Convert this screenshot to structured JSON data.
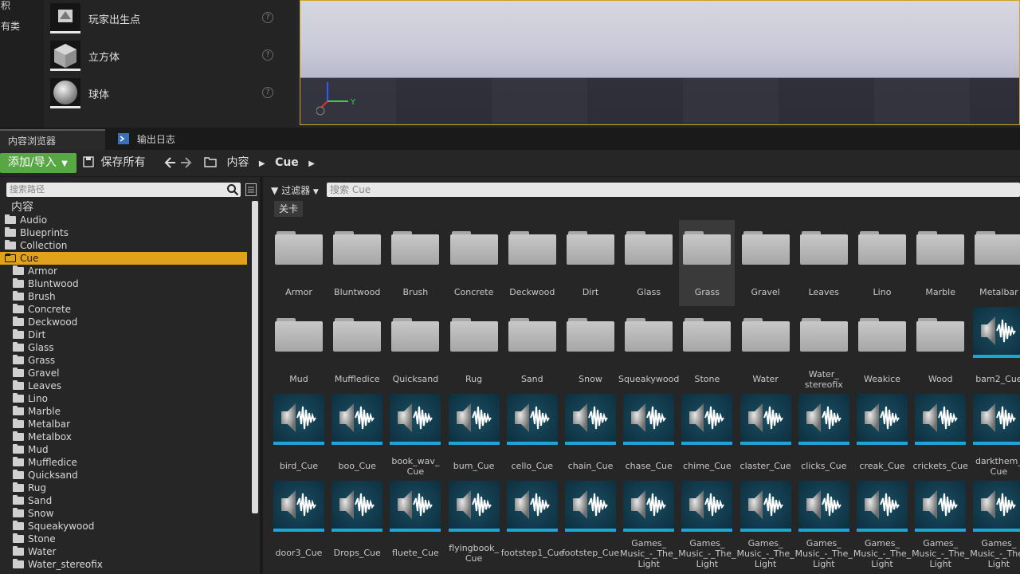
{
  "left_categories": [
    "积",
    "有类"
  ],
  "place_items": [
    {
      "label": "玩家出生点",
      "icon": "player-start-icon"
    },
    {
      "label": "立方体",
      "icon": "cube-icon"
    },
    {
      "label": "球体",
      "icon": "sphere-icon"
    }
  ],
  "viewport": {
    "axis_y_label": "Y"
  },
  "tabs": {
    "content_browser": "内容浏览器",
    "output_log": "输出日志"
  },
  "toolbar": {
    "add_import": "添加/导入",
    "save_all": "保存所有",
    "crumbs": [
      "内容",
      "Cue"
    ]
  },
  "tree_search_placeholder": "搜索路径",
  "tree": [
    {
      "label": "内容",
      "level": 0
    },
    {
      "label": "Audio",
      "level": 1
    },
    {
      "label": "Blueprints",
      "level": 1
    },
    {
      "label": "Collection",
      "level": 1
    },
    {
      "label": "Cue",
      "level": 1,
      "selected": true
    },
    {
      "label": "Armor",
      "level": 2
    },
    {
      "label": "Bluntwood",
      "level": 2
    },
    {
      "label": "Brush",
      "level": 2
    },
    {
      "label": "Concrete",
      "level": 2
    },
    {
      "label": "Deckwood",
      "level": 2
    },
    {
      "label": "Dirt",
      "level": 2
    },
    {
      "label": "Glass",
      "level": 2
    },
    {
      "label": "Grass",
      "level": 2
    },
    {
      "label": "Gravel",
      "level": 2
    },
    {
      "label": "Leaves",
      "level": 2
    },
    {
      "label": "Lino",
      "level": 2
    },
    {
      "label": "Marble",
      "level": 2
    },
    {
      "label": "Metalbar",
      "level": 2
    },
    {
      "label": "Metalbox",
      "level": 2
    },
    {
      "label": "Mud",
      "level": 2
    },
    {
      "label": "Muffledice",
      "level": 2
    },
    {
      "label": "Quicksand",
      "level": 2
    },
    {
      "label": "Rug",
      "level": 2
    },
    {
      "label": "Sand",
      "level": 2
    },
    {
      "label": "Snow",
      "level": 2
    },
    {
      "label": "Squeakywood",
      "level": 2
    },
    {
      "label": "Stone",
      "level": 2
    },
    {
      "label": "Water",
      "level": 2
    },
    {
      "label": "Water_stereofix",
      "level": 2
    }
  ],
  "filter": {
    "label": "过滤器",
    "search_placeholder": "搜索 Cue",
    "chip": "关卡"
  },
  "assets": [
    {
      "name": "Armor",
      "kind": "folder"
    },
    {
      "name": "Bluntwood",
      "kind": "folder"
    },
    {
      "name": "Brush",
      "kind": "folder"
    },
    {
      "name": "Concrete",
      "kind": "folder"
    },
    {
      "name": "Deckwood",
      "kind": "folder"
    },
    {
      "name": "Dirt",
      "kind": "folder"
    },
    {
      "name": "Glass",
      "kind": "folder"
    },
    {
      "name": "Grass",
      "kind": "folder",
      "hover": true
    },
    {
      "name": "Gravel",
      "kind": "folder"
    },
    {
      "name": "Leaves",
      "kind": "folder"
    },
    {
      "name": "Lino",
      "kind": "folder"
    },
    {
      "name": "Marble",
      "kind": "folder"
    },
    {
      "name": "Metalbar",
      "kind": "folder"
    },
    {
      "name": "Mud",
      "kind": "folder"
    },
    {
      "name": "Muffledice",
      "kind": "folder"
    },
    {
      "name": "Quicksand",
      "kind": "folder"
    },
    {
      "name": "Rug",
      "kind": "folder"
    },
    {
      "name": "Sand",
      "kind": "folder"
    },
    {
      "name": "Snow",
      "kind": "folder"
    },
    {
      "name": "Squeakywood",
      "kind": "folder"
    },
    {
      "name": "Stone",
      "kind": "folder"
    },
    {
      "name": "Water",
      "kind": "folder"
    },
    {
      "name": "Water_ stereofix",
      "kind": "folder"
    },
    {
      "name": "Weakice",
      "kind": "folder"
    },
    {
      "name": "Wood",
      "kind": "folder"
    },
    {
      "name": "bam2_Cue",
      "kind": "cue"
    },
    {
      "name": "bird_Cue",
      "kind": "cue"
    },
    {
      "name": "boo_Cue",
      "kind": "cue"
    },
    {
      "name": "book_wav_ Cue",
      "kind": "cue"
    },
    {
      "name": "bum_Cue",
      "kind": "cue"
    },
    {
      "name": "cello_Cue",
      "kind": "cue"
    },
    {
      "name": "chain_Cue",
      "kind": "cue"
    },
    {
      "name": "chase_Cue",
      "kind": "cue"
    },
    {
      "name": "chime_Cue",
      "kind": "cue"
    },
    {
      "name": "claster_Cue",
      "kind": "cue"
    },
    {
      "name": "clicks_Cue",
      "kind": "cue"
    },
    {
      "name": "creak_Cue",
      "kind": "cue"
    },
    {
      "name": "crickets_Cue",
      "kind": "cue"
    },
    {
      "name": "darkthem_ Cue",
      "kind": "cue"
    },
    {
      "name": "door3_Cue",
      "kind": "cue"
    },
    {
      "name": "Drops_Cue",
      "kind": "cue"
    },
    {
      "name": "fluete_Cue",
      "kind": "cue"
    },
    {
      "name": "flyingbook_ Cue",
      "kind": "cue"
    },
    {
      "name": "footstep1_Cue",
      "kind": "cue"
    },
    {
      "name": "footstep_Cue",
      "kind": "cue"
    },
    {
      "name": "Games_ Music_-_The_ Light",
      "kind": "cue"
    },
    {
      "name": "Games_ Music_-_The_ Light",
      "kind": "cue"
    },
    {
      "name": "Games_ Music_-_The_ Light",
      "kind": "cue"
    },
    {
      "name": "Games_ Music_-_The_ Light",
      "kind": "cue"
    },
    {
      "name": "Games_ Music_-_The_ Light",
      "kind": "cue"
    },
    {
      "name": "Games_ Music_-_The_ Light",
      "kind": "cue"
    },
    {
      "name": "Games_ Music_-_The_ Light",
      "kind": "cue"
    }
  ],
  "colors": {
    "accent_add": "#57a845",
    "selected_tree": "#e0a21b",
    "cue_bar": "#1ea5d6",
    "viewport_border": "#c9a526"
  }
}
